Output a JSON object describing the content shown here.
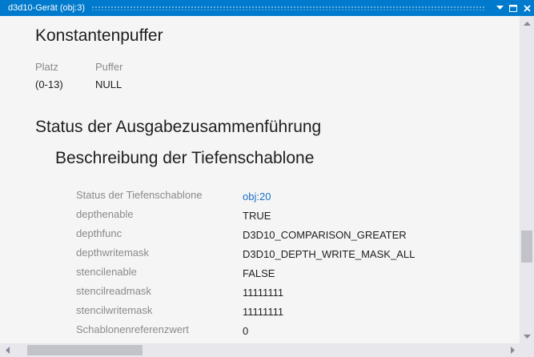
{
  "window": {
    "title": "d3d10-Gerät (obj:3)",
    "accent_color": "#007acc",
    "buttons": [
      "dropdown-icon",
      "maximize-icon",
      "close-icon"
    ]
  },
  "constant_buffer": {
    "heading": "Konstantenpuffer",
    "col_slot": "Platz",
    "col_buffer": "Puffer",
    "slot_value": "(0-13)",
    "buffer_value": "NULL"
  },
  "output_merger": {
    "heading": "Status der Ausgabezusammenführung",
    "depth_stencil": {
      "heading": "Beschreibung der Tiefenschablone",
      "rows": [
        {
          "label": "Status der Tiefenschablone",
          "value": "obj:20",
          "is_link": true
        },
        {
          "label": "depthenable",
          "value": "TRUE"
        },
        {
          "label": "depthfunc",
          "value": "D3D10_COMPARISON_GREATER"
        },
        {
          "label": "depthwritemask",
          "value": "D3D10_DEPTH_WRITE_MASK_ALL"
        },
        {
          "label": "stencilenable",
          "value": "FALSE"
        },
        {
          "label": "stencilreadmask",
          "value": "11111111"
        },
        {
          "label": "stencilwritemask",
          "value": "11111111"
        },
        {
          "label": "Schablonenreferenzwert",
          "value": "0"
        }
      ]
    }
  },
  "colors": {
    "link": "#1a6fc4",
    "label": "#8a8a8a",
    "text": "#1e1e1e",
    "background": "#f5f5f5"
  }
}
